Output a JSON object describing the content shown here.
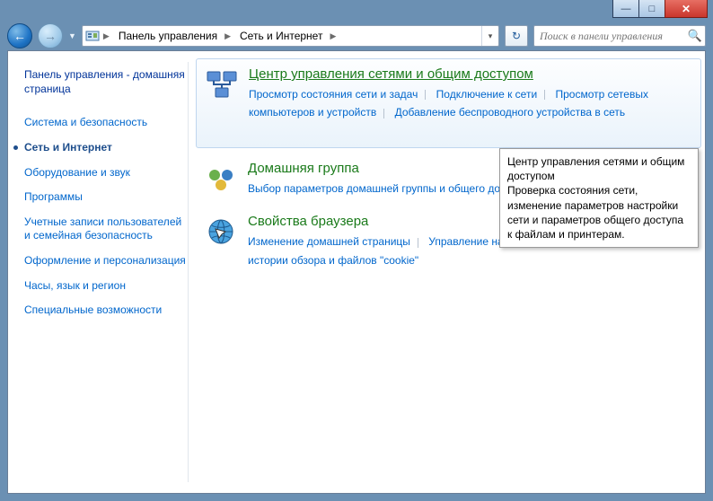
{
  "window_controls": {
    "min": "—",
    "max": "□",
    "close": "✕"
  },
  "breadcrumb": {
    "root": "Панель управления",
    "sub": "Сеть и Интернет"
  },
  "search": {
    "placeholder": "Поиск в панели управления"
  },
  "sidebar": {
    "home": "Панель управления - домашняя страница",
    "items": [
      {
        "label": "Система и безопасность",
        "current": false
      },
      {
        "label": "Сеть и Интернет",
        "current": true
      },
      {
        "label": "Оборудование и звук",
        "current": false
      },
      {
        "label": "Программы",
        "current": false
      },
      {
        "label": "Учетные записи пользователей и семейная безопасность",
        "current": false
      },
      {
        "label": "Оформление и персонализация",
        "current": false
      },
      {
        "label": "Часы, язык и регион",
        "current": false
      },
      {
        "label": "Специальные возможности",
        "current": false
      }
    ]
  },
  "sections": [
    {
      "id": "network-sharing",
      "title": "Центр управления сетями и общим доступом",
      "highlight": true,
      "links": [
        "Просмотр состояния сети и задач",
        "Подключение к сети",
        "Просмотр сетевых компьютеров и устройств",
        "Добавление беспроводного устройства в сеть"
      ]
    },
    {
      "id": "homegroup",
      "title": "Домашняя группа",
      "highlight": false,
      "links": [
        "Выбор параметров домашней группы и общего доступа к данным"
      ]
    },
    {
      "id": "internet-options",
      "title": "Свойства браузера",
      "highlight": false,
      "links": [
        "Изменение домашней страницы",
        "Управление надстройками браузера",
        "Удаление истории обзора и файлов \"cookie\""
      ]
    }
  ],
  "tooltip": {
    "title": "Центр управления сетями и общим доступом",
    "body": "Проверка состояния сети, изменение параметров настройки сети и параметров общего доступа к файлам и принтерам."
  }
}
